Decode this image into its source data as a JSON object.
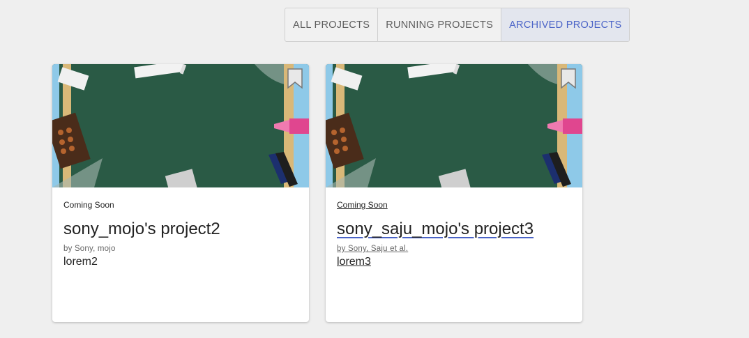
{
  "tabs": [
    {
      "label": "ALL PROJECTS",
      "active": false
    },
    {
      "label": "RUNNING PROJECTS",
      "active": false
    },
    {
      "label": "ARCHIVED PROJECTS",
      "active": true
    }
  ],
  "colors": {
    "accent": "#4a63c7",
    "chalkboard": "#2a5a45",
    "background": "#efefef"
  },
  "cards": [
    {
      "status": "Coming Soon",
      "title": "sony_mojo's project2",
      "byline": "by Sony, mojo",
      "description": "lorem2",
      "image": "chalkboard-with-school-supplies",
      "icon": "bookmark-icon"
    },
    {
      "status": "Coming Soon",
      "title": "sony_saju_mojo's project3",
      "byline": "by Sony, Saju et al.",
      "description": "lorem3",
      "image": "chalkboard-with-school-supplies",
      "icon": "bookmark-icon"
    }
  ]
}
